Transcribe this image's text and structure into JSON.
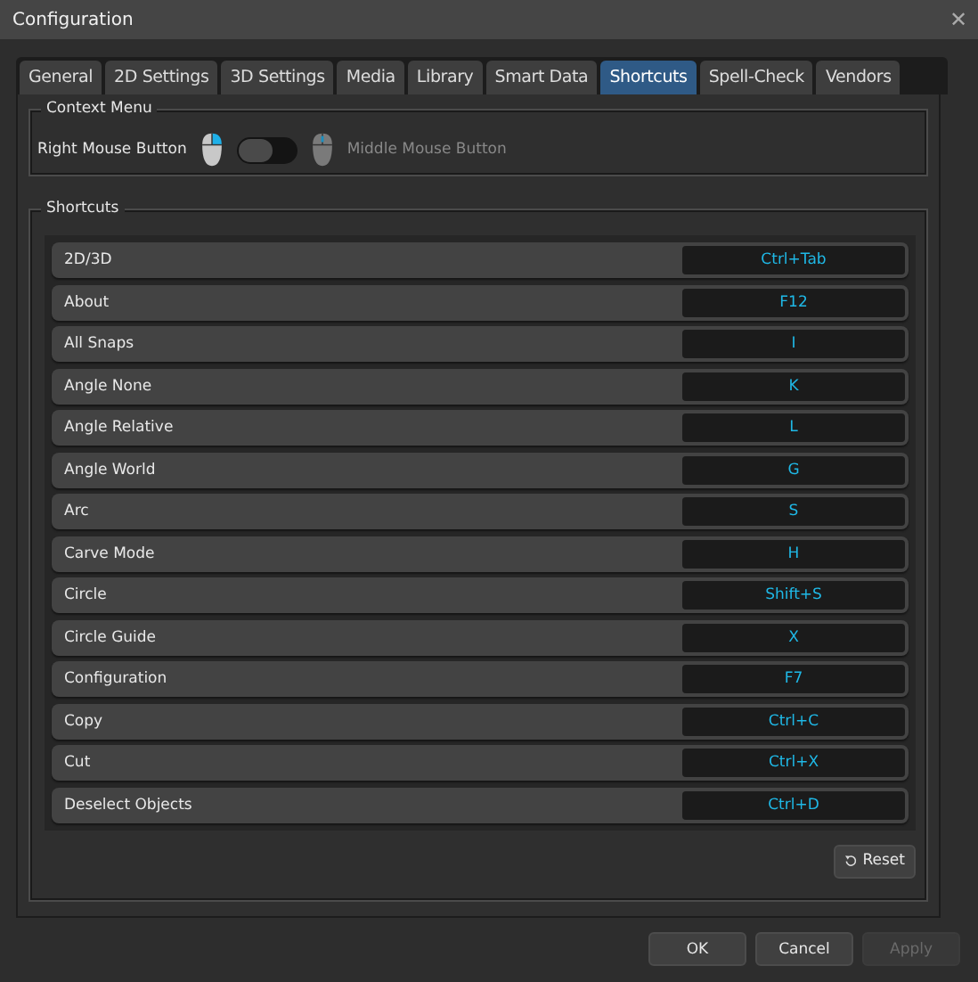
{
  "window": {
    "title": "Configuration",
    "close": "✕"
  },
  "tabs": [
    {
      "label": "General",
      "selected": false
    },
    {
      "label": "2D Settings",
      "selected": false
    },
    {
      "label": "3D Settings",
      "selected": false
    },
    {
      "label": "Media",
      "selected": false
    },
    {
      "label": "Library",
      "selected": false
    },
    {
      "label": "Smart Data",
      "selected": false
    },
    {
      "label": "Shortcuts",
      "selected": true
    },
    {
      "label": "Spell-Check",
      "selected": false
    },
    {
      "label": "Vendors",
      "selected": false
    }
  ],
  "context_menu": {
    "title": "Context Menu",
    "left_label": "Right Mouse Button",
    "right_label": "Middle Mouse Button",
    "on": false
  },
  "shortcuts": {
    "title": "Shortcuts",
    "rows": [
      {
        "command": "2D/3D",
        "key": "Ctrl+Tab"
      },
      {
        "command": "About",
        "key": "F12"
      },
      {
        "command": "All Snaps",
        "key": "I"
      },
      {
        "command": "Angle None",
        "key": "K"
      },
      {
        "command": "Angle Relative",
        "key": "L"
      },
      {
        "command": "Angle World",
        "key": "G"
      },
      {
        "command": "Arc",
        "key": "S"
      },
      {
        "command": "Carve Mode",
        "key": "H"
      },
      {
        "command": "Circle",
        "key": "Shift+S"
      },
      {
        "command": "Circle Guide",
        "key": "X"
      },
      {
        "command": "Configuration",
        "key": "F7"
      },
      {
        "command": "Copy",
        "key": "Ctrl+C"
      },
      {
        "command": "Cut",
        "key": "Ctrl+X"
      },
      {
        "command": "Deselect Objects",
        "key": "Ctrl+D"
      }
    ],
    "reset": "Reset"
  },
  "buttons": [
    {
      "label": "OK",
      "disabled": false
    },
    {
      "label": "Cancel",
      "disabled": false
    },
    {
      "label": "Apply",
      "disabled": true
    }
  ]
}
